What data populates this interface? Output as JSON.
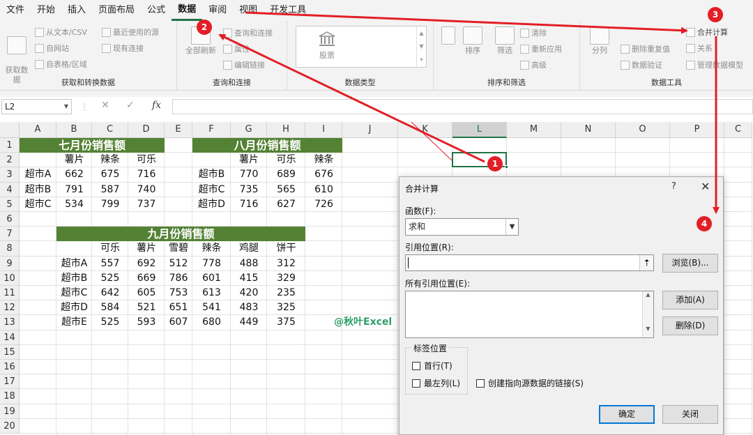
{
  "menu": [
    "文件",
    "开始",
    "插入",
    "页面布局",
    "公式",
    "数据",
    "审阅",
    "视图",
    "开发工具"
  ],
  "menu_active": "数据",
  "ribbon": {
    "get_transform": {
      "label": "获取和转换数据",
      "big_label": "获取数\n据",
      "items": [
        "从文本/CSV",
        "自网站",
        "自表格/区域",
        "最近使用的源",
        "现有连接"
      ]
    },
    "queries": {
      "label": "查询和连接",
      "refresh_all": "全部刷新",
      "items": [
        "查询和连接",
        "属性",
        "编辑链接"
      ]
    },
    "data_types": {
      "label": "数据类型",
      "stock": "股票"
    },
    "sort_filter": {
      "label": "排序和筛选",
      "sort": "排序",
      "filter": "筛选",
      "items": [
        "清除",
        "重新应用",
        "高级"
      ]
    },
    "data_tools": {
      "label": "数据工具",
      "split": "分列",
      "items": [
        "删除重复值",
        "数据验证",
        "合并计算",
        "关系",
        "管理数据模型"
      ]
    }
  },
  "formula_bar": {
    "name_box": "L2",
    "cancel": "✕",
    "enter": "✓",
    "fx": "fx",
    "formula": ""
  },
  "sheet": {
    "columns": [
      "A",
      "B",
      "C",
      "D",
      "E",
      "F",
      "G",
      "H",
      "I",
      "J",
      "K",
      "L",
      "M",
      "N",
      "O",
      "P",
      "C"
    ],
    "selected_column": "L",
    "rows": [
      "1",
      "2",
      "3",
      "4",
      "5",
      "6",
      "7",
      "8",
      "9",
      "10",
      "11",
      "12",
      "13",
      "14",
      "15",
      "16",
      "17",
      "18",
      "19",
      "20"
    ],
    "selected_row": "2",
    "july": {
      "title": "七月份销售额",
      "headers": [
        "薯片",
        "辣条",
        "可乐"
      ],
      "rows": [
        [
          "超市A",
          "662",
          "675",
          "716"
        ],
        [
          "超市B",
          "791",
          "587",
          "740"
        ],
        [
          "超市C",
          "534",
          "799",
          "737"
        ]
      ]
    },
    "august": {
      "title": "八月份销售额",
      "headers": [
        "薯片",
        "可乐",
        "辣条"
      ],
      "rows": [
        [
          "超市B",
          "770",
          "689",
          "676"
        ],
        [
          "超市C",
          "735",
          "565",
          "610"
        ],
        [
          "超市D",
          "716",
          "627",
          "726"
        ]
      ]
    },
    "september": {
      "title": "九月份销售额",
      "headers": [
        "可乐",
        "薯片",
        "雪碧",
        "辣条",
        "鸡腿",
        "饼干"
      ],
      "rows": [
        [
          "超市A",
          "557",
          "692",
          "512",
          "778",
          "488",
          "312"
        ],
        [
          "超市B",
          "525",
          "669",
          "786",
          "601",
          "415",
          "329"
        ],
        [
          "超市C",
          "642",
          "605",
          "753",
          "613",
          "420",
          "235"
        ],
        [
          "超市D",
          "584",
          "521",
          "651",
          "541",
          "483",
          "325"
        ],
        [
          "超市E",
          "525",
          "593",
          "607",
          "680",
          "449",
          "375"
        ]
      ]
    },
    "watermark": "@秋叶Excel"
  },
  "dialog": {
    "title": "合并计算",
    "help": "?",
    "close": "✕",
    "function_label": "函数(F):",
    "function_value": "求和",
    "reference_label": "引用位置(R):",
    "reference_value": "",
    "browse": "浏览(B)...",
    "all_refs_label": "所有引用位置(E):",
    "add": "添加(A)",
    "delete": "删除(D)",
    "label_group": "标签位置",
    "top_row": "首行(T)",
    "left_column": "最左列(L)",
    "create_links": "创建指向源数据的链接(S)",
    "ok": "确定",
    "cancel": "关闭"
  },
  "annotations": [
    "1",
    "2",
    "3",
    "4"
  ],
  "colors": {
    "accent": "#217346",
    "title_fill": "#548235",
    "annotation": "#e21e26",
    "watermark": "#2e9e6a"
  }
}
